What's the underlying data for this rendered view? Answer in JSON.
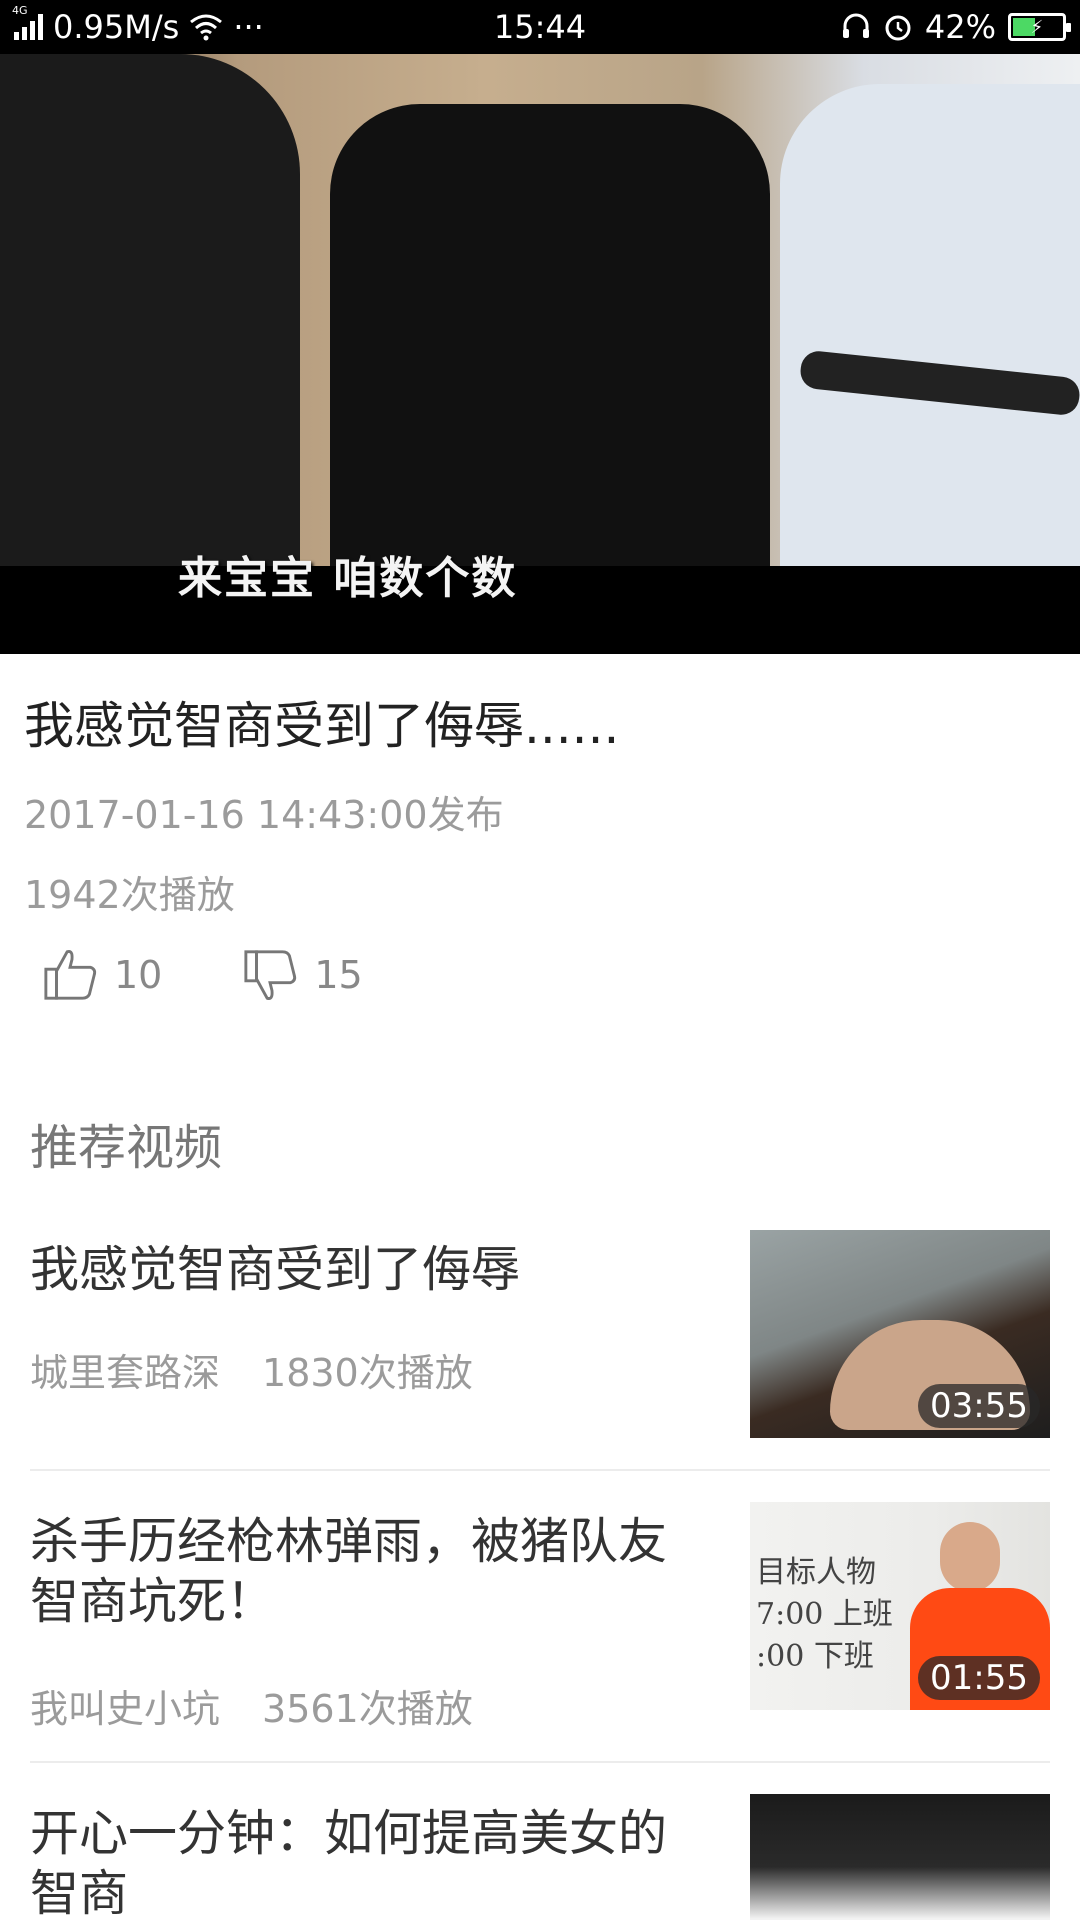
{
  "status_bar": {
    "network": "4G",
    "speed": "0.95M/s",
    "more": "···",
    "time": "15:44",
    "battery": "42%",
    "battery_level": 0.42
  },
  "video": {
    "subtitle": "来宝宝 咱数个数"
  },
  "info": {
    "title": "我感觉智商受到了侮辱......",
    "published": "2017-01-16 14:43:00发布",
    "plays": "1942次播放",
    "likes": "10",
    "dislikes": "15"
  },
  "recommend": {
    "heading": "推荐视频",
    "items": [
      {
        "title": "我感觉智商受到了侮辱",
        "author": "城里套路深",
        "plays": "1830次播放",
        "duration": "03:55"
      },
      {
        "title": "杀手历经枪林弹雨，被猪队友智商坑死！",
        "author": "我叫史小坑",
        "plays": "3561次播放",
        "duration": "01:55"
      },
      {
        "title": " 开心一分钟：如何提高美女的智商",
        "author": "",
        "plays": "",
        "duration": ""
      }
    ],
    "thumb2_board": "目标人物\n7:00 上班\n:00 下班"
  },
  "colors": {
    "status_bar_bg": "#000000",
    "battery_fill": "#4cd964",
    "meta_text": "#9b9b9b"
  }
}
